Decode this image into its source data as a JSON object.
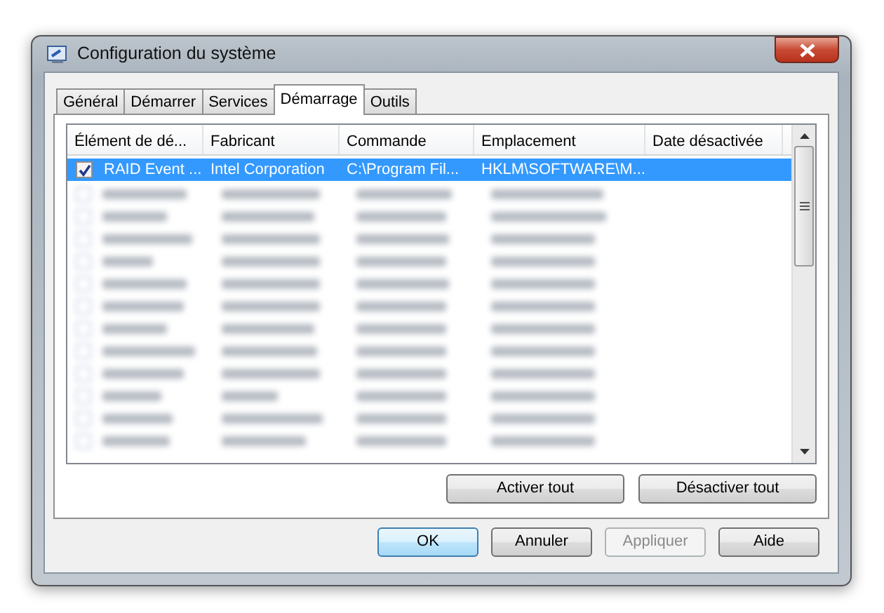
{
  "window": {
    "title": "Configuration du système"
  },
  "tabs": [
    {
      "label": "Général",
      "selected": false
    },
    {
      "label": "Démarrer",
      "selected": false
    },
    {
      "label": "Services",
      "selected": false
    },
    {
      "label": "Démarrage",
      "selected": true
    },
    {
      "label": "Outils",
      "selected": false
    }
  ],
  "table": {
    "columns": [
      "Élément de dé...",
      "Fabricant",
      "Commande",
      "Emplacement",
      "Date désactivée"
    ],
    "rows": [
      {
        "checked": true,
        "selected": true,
        "cells": [
          "RAID Event ...",
          "Intel Corporation",
          "C:\\Program Fil...",
          "HKLM\\SOFTWARE\\M...",
          ""
        ]
      }
    ]
  },
  "list_buttons": [
    "Activer tout",
    "Désactiver tout"
  ],
  "buttons": [
    {
      "label": "OK",
      "kind": "default",
      "disabled": false
    },
    {
      "label": "Annuler",
      "kind": "normal",
      "disabled": false
    },
    {
      "label": "Appliquer",
      "kind": "normal",
      "disabled": true
    },
    {
      "label": "Aide",
      "kind": "normal",
      "disabled": false
    }
  ]
}
